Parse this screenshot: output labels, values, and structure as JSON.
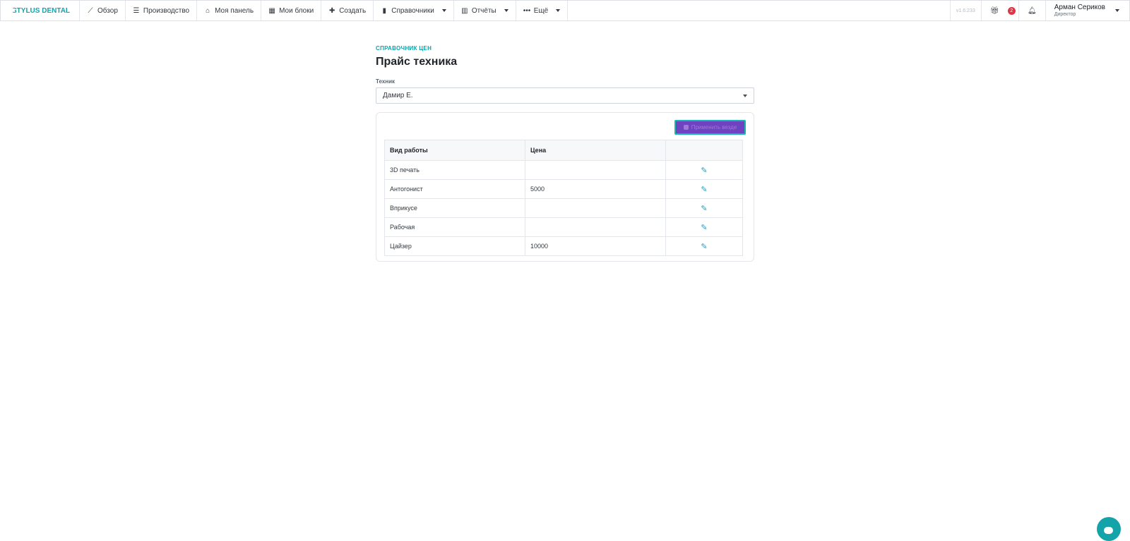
{
  "brand": {
    "name": "STYLUS DENTAL"
  },
  "nav": [
    {
      "label": "Обзор",
      "icon": "chart-line-icon",
      "glyph": "⟋",
      "dropdown": false
    },
    {
      "label": "Производство",
      "icon": "list-icon",
      "glyph": "☰",
      "dropdown": false
    },
    {
      "label": "Моя панель",
      "icon": "home-icon",
      "glyph": "⌂",
      "dropdown": false
    },
    {
      "label": "Мои блоки",
      "icon": "grid-icon",
      "glyph": "▦",
      "dropdown": false
    },
    {
      "label": "Создать",
      "icon": "plus-icon",
      "glyph": "✚",
      "dropdown": false
    },
    {
      "label": "Справочники",
      "icon": "book-icon",
      "glyph": "▮",
      "dropdown": true
    },
    {
      "label": "Отчёты",
      "icon": "bar-chart-icon",
      "glyph": "▥",
      "dropdown": true
    },
    {
      "label": "Ещё",
      "icon": "ellipsis-icon",
      "glyph": "•••",
      "dropdown": true
    }
  ],
  "version": "v1.6.233",
  "notifications": {
    "gift_count": "2"
  },
  "user": {
    "name": "Арман Сериков",
    "role": "Директор"
  },
  "page": {
    "eyebrow": "СПРАВОЧНИК ЦЕН",
    "title": "Прайс техника",
    "technician_label": "Техник",
    "technician_value": "Дамир Е.",
    "apply_button": "Применить везде"
  },
  "table": {
    "headers": [
      "Вид работы",
      "Цена",
      ""
    ],
    "rows": [
      {
        "work": "3D печать",
        "price": ""
      },
      {
        "work": "Антогонист",
        "price": "5000"
      },
      {
        "work": "Вприкусе",
        "price": ""
      },
      {
        "work": "Рабочая",
        "price": ""
      },
      {
        "work": "Цайзер",
        "price": "10000"
      }
    ]
  },
  "colors": {
    "accent": "#13a3a8",
    "button_bg": "#6f42c1",
    "badge": "#dc3545"
  }
}
